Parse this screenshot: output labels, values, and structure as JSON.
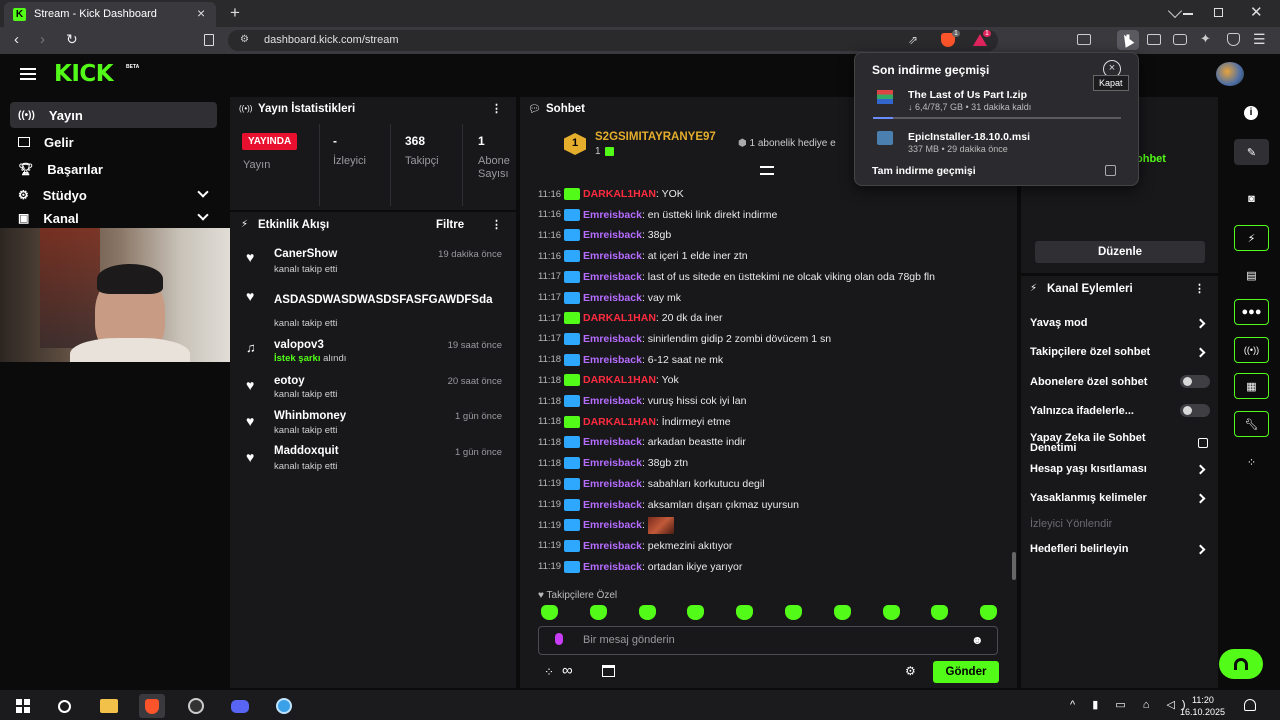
{
  "browser": {
    "tab_title": "Stream - Kick Dashboard",
    "url": "dashboard.kick.com/stream",
    "brave_badge": "1",
    "rewards_badge": "1"
  },
  "brand": {
    "logo": "KICK",
    "logo_sup": "BETA",
    "accent": "#53fc18"
  },
  "sidebar": {
    "items": [
      {
        "label": "Yayın",
        "icon": "broadcast-icon"
      },
      {
        "label": "Gelir",
        "icon": "revenue-icon"
      },
      {
        "label": "Başarılar",
        "icon": "trophy-icon"
      },
      {
        "label": "Stüdyo",
        "icon": "studio-icon"
      },
      {
        "label": "Kanal",
        "icon": "channel-icon"
      }
    ]
  },
  "stats": {
    "title": "Yayın İstatistikleri",
    "live_badge": "YAYINDA",
    "stream_label": "Yayın",
    "viewers_value": "-",
    "viewers_label": "İzleyici",
    "followers_value": "368",
    "followers_label": "Takipçi",
    "subs_value": "1",
    "subs_label": "Abone Sayısı"
  },
  "activity": {
    "title": "Etkinlik Akışı",
    "filter": "Filtre",
    "items": [
      {
        "name": "CanerShow",
        "sub": "kanalı takip etti",
        "time": "19 dakika önce"
      },
      {
        "name": "ASDASDWASDWASDSFASFGAWDFSda",
        "sub": "kanalı takip etti",
        "time": ""
      },
      {
        "name": "valopov3",
        "sub_hl": "İstek şarkı",
        "sub": " alındı",
        "time": "19 saat önce"
      },
      {
        "name": "eotoy",
        "sub": "kanalı takip etti",
        "time": "20 saat önce"
      },
      {
        "name": "Whinbmoney",
        "sub": "kanalı takip etti",
        "time": "1 gün önce"
      },
      {
        "name": "Maddoxquit",
        "sub": "kanalı takip etti",
        "time": "1 gün önce"
      }
    ]
  },
  "chat": {
    "title": "Sohbet",
    "pinned_user": "S2GSIMITAYRANYE97",
    "pinned_count": "1",
    "pinned_rank": "1",
    "pinned_gift": "1 abonelik hediye e",
    "messages": [
      {
        "time": "11:16",
        "user": "DARKAL1HAN",
        "text": ": YOK",
        "role": "mod"
      },
      {
        "time": "11:16",
        "user": "Emreisback",
        "text": ": en üstteki link direkt indirme",
        "role": "owner"
      },
      {
        "time": "11:16",
        "user": "Emreisback",
        "text": ": 38gb",
        "role": "owner"
      },
      {
        "time": "11:16",
        "user": "Emreisback",
        "text": ": at içeri 1 elde iner ztn",
        "role": "owner"
      },
      {
        "time": "11:17",
        "user": "Emreisback",
        "text": ": last of us sitede en üsttekimi ne olcak viking olan oda 78gb fln",
        "role": "owner"
      },
      {
        "time": "11:17",
        "user": "Emreisback",
        "text": ": vay mk",
        "role": "owner"
      },
      {
        "time": "11:17",
        "user": "DARKAL1HAN",
        "text": ": 20 dk da iner",
        "role": "mod"
      },
      {
        "time": "11:17",
        "user": "Emreisback",
        "text": ": sinirlendim gidip 2 zombi dövücem 1 sn",
        "role": "owner"
      },
      {
        "time": "11:18",
        "user": "Emreisback",
        "text": ": 6-12 saat ne mk",
        "role": "owner"
      },
      {
        "time": "11:18",
        "user": "DARKAL1HAN",
        "text": ": Yok",
        "role": "mod"
      },
      {
        "time": "11:18",
        "user": "Emreisback",
        "text": ": vuruş hissi cok iyi lan",
        "role": "owner"
      },
      {
        "time": "11:18",
        "user": "DARKAL1HAN",
        "text": ": İndirmeyi etme",
        "role": "mod"
      },
      {
        "time": "11:18",
        "user": "Emreisback",
        "text": ": arkadan beastte indir",
        "role": "owner"
      },
      {
        "time": "11:18",
        "user": "Emreisback",
        "text": ": 38gb ztn",
        "role": "owner"
      },
      {
        "time": "11:19",
        "user": "Emreisback",
        "text": ": sabahları korkutucu degil",
        "role": "owner"
      },
      {
        "time": "11:19",
        "user": "Emreisback",
        "text": ": aksamları dışarı çıkmaz uyursun",
        "role": "owner"
      },
      {
        "time": "11:19",
        "user": "Emreisback",
        "text": ":",
        "role": "owner",
        "emote": true
      },
      {
        "time": "11:19",
        "user": "Emreisback",
        "text": ": pekmezini akıtıyor",
        "role": "owner"
      },
      {
        "time": "11:19",
        "user": "Emreisback",
        "text": ": ortadan ikiye yarıyor",
        "role": "owner"
      }
    ],
    "followers_only": "Takipçilere Özel",
    "input_placeholder": "Bir mesaj gönderin",
    "send": "Gönder"
  },
  "downloads": {
    "title": "Son indirme geçmişi",
    "close_tooltip": "Kapat",
    "items": [
      {
        "name": "The Last of Us Part I.zip",
        "detail": "↓ 6,4/78,7 GB • 31 dakika kaldı",
        "progress": 0.08
      },
      {
        "name": "EpicInstaller-18.10.0.msi",
        "detail": "337 MB • 29 dakika önce"
      }
    ],
    "full_history": "Tam indirme geçmişi"
  },
  "right_panel": {
    "partial": "ohbet",
    "edit": "Düzenle"
  },
  "channel_actions": {
    "title": "Kanal Eylemleri",
    "items": [
      {
        "label": "Yavaş mod",
        "ctrl": "chevron"
      },
      {
        "label": "Takipçilere özel sohbet",
        "ctrl": "chevron"
      },
      {
        "label": "Abonelere özel sohbet",
        "ctrl": "toggle"
      },
      {
        "label": "Yalnızca ifadelerle...",
        "ctrl": "toggle"
      },
      {
        "label": "Yapay Zeka ile Sohbet Denetimi",
        "ctrl": "ext"
      },
      {
        "label": "Hesap yaşı kısıtlaması",
        "ctrl": "chevron"
      },
      {
        "label": "Yasaklanmış kelimeler",
        "ctrl": "chevron"
      },
      {
        "label": "İzleyici Yönlendir",
        "ctrl": "none",
        "disabled": true
      },
      {
        "label": "Hedefleri belirleyin",
        "ctrl": "chevron"
      }
    ]
  },
  "taskbar": {
    "time": "11:20",
    "date": "16.10.2025"
  }
}
